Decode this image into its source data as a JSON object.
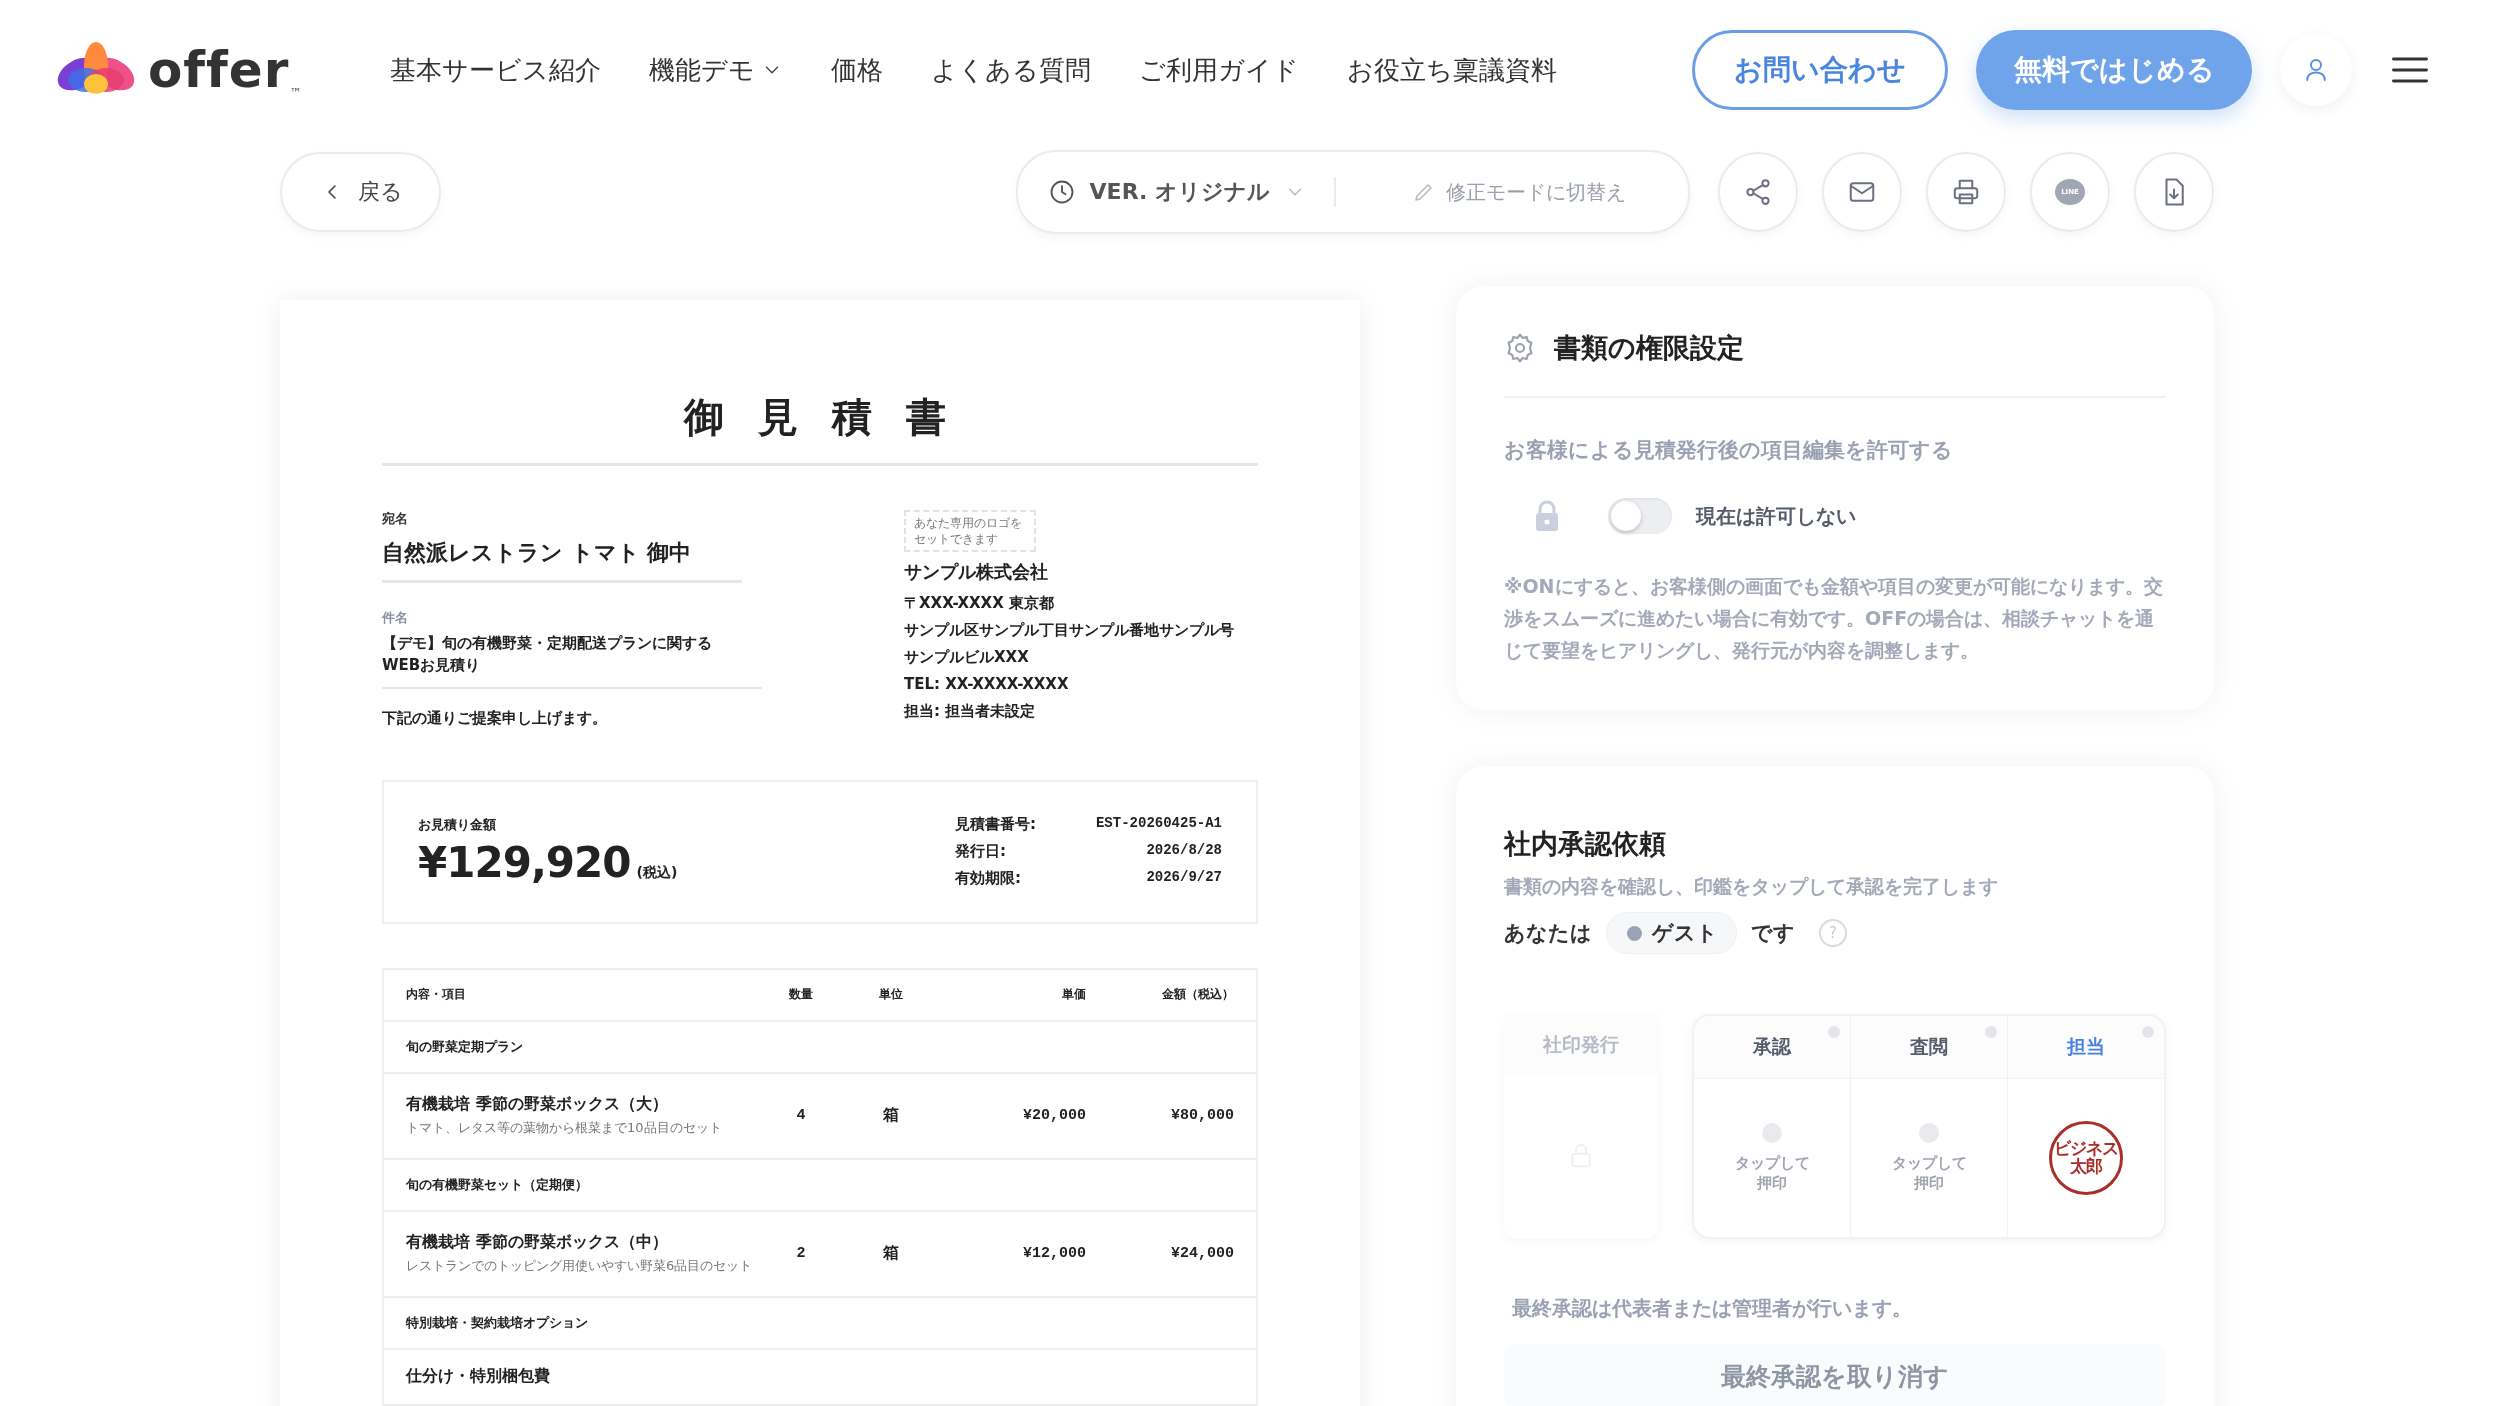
{
  "header": {
    "logo": "offer",
    "logo_mark": "™",
    "nav": [
      {
        "label": "基本サービス紹介",
        "dropdown": false
      },
      {
        "label": "機能デモ",
        "dropdown": true
      },
      {
        "label": "価格",
        "dropdown": false
      },
      {
        "label": "よくある質問",
        "dropdown": false
      },
      {
        "label": "ご利用ガイド",
        "dropdown": false
      },
      {
        "label": "お役立ち稟議資料",
        "dropdown": false
      }
    ],
    "contact_button": "お問い合わせ",
    "start_button": "無料ではじめる"
  },
  "toolbar": {
    "back": "戻る",
    "version": "VER. オリジナル",
    "edit_mode": "修正モードに切替え",
    "actions": [
      {
        "kind": "share"
      },
      {
        "kind": "mail"
      },
      {
        "kind": "print"
      },
      {
        "kind": "line"
      },
      {
        "kind": "download"
      }
    ],
    "line_label": "LINE"
  },
  "document": {
    "title": "御 見 積 書",
    "recipient_label": "宛名",
    "recipient": "自然派レストラン トマト 御中",
    "subject_label": "件名",
    "subject": "【デモ】旬の有機野菜・定期配送プランに関する\nWEBお見積り",
    "intro": "下記の通りご提案申し上げます。",
    "logo_placeholder": "あなた専用のロゴをセットできます",
    "issuer": [
      "サンプル株式会社",
      "〒XXX-XXXX 東京都",
      "サンプル区サンプル丁目サンプル番地サンプル号",
      "サンプルビルXXX",
      "TEL: XX-XXXX-XXXX",
      "担当: 担当者未設定"
    ],
    "total_label": "お見積り金額",
    "total": "¥129,920",
    "total_note": "(税込)",
    "meta": [
      {
        "label": "見積書番号:",
        "value": "EST-20260425-A1"
      },
      {
        "label": "発行日:",
        "value": "2026/8/28"
      },
      {
        "label": "有効期限:",
        "value": "2026/9/27"
      }
    ],
    "table": {
      "columns": [
        "内容・項目",
        "数量",
        "単位",
        "単価",
        "金額（税込）"
      ],
      "rows": [
        {
          "kind": "group",
          "title": "旬の野菜定期プラン"
        },
        {
          "kind": "item",
          "title": "有機栽培 季節の野菜ボックス（大）",
          "note": "トマト、レタス等の葉物から根菜まで10品目のセット",
          "qty": "4",
          "unit": "箱",
          "price": "¥20,000",
          "amount": "¥80,000"
        },
        {
          "kind": "group",
          "title": "旬の有機野菜セット（定期便）"
        },
        {
          "kind": "item",
          "title": "有機栽培 季節の野菜ボックス（中）",
          "note": "レストランでのトッピング用使いやすい野菜6品目のセット",
          "qty": "2",
          "unit": "箱",
          "price": "¥12,000",
          "amount": "¥24,000"
        },
        {
          "kind": "group",
          "title": "特別栽培・契約栽培オプション"
        },
        {
          "kind": "partial",
          "title": "仕分け・特別梱包費"
        }
      ]
    }
  },
  "permissions": {
    "title": "書類の権限設定",
    "label": "お客様による見積発行後の項目編集を許可する",
    "locked": true,
    "toggle_on": false,
    "toggle_label": "現在は許可しない",
    "note": "※ONにすると、お客様側の画面でも金額や項目の変更が可能になります。交渉をスムーズに進めたい場合に有効です。OFFの場合は、相談チャットを通じて要望をヒアリングし、発行元が内容を調整します。"
  },
  "approval": {
    "title": "社内承認依頼",
    "subtitle": "書類の内容を確認し、印鑑をタップして承認を完了します",
    "you_prefix": "あなたは",
    "role": "ゲスト",
    "you_suffix": "です",
    "help": "?",
    "company_seal": {
      "label": "社印発行",
      "locked": true
    },
    "stamps": [
      {
        "label": "承認",
        "kind": "empty",
        "selected": false,
        "hint": "タップして押印"
      },
      {
        "label": "査閲",
        "kind": "empty",
        "selected": false,
        "hint": "タップして押印"
      },
      {
        "label": "担当",
        "kind": "stamped",
        "selected": true,
        "seal": [
          "ビジネス",
          "太郎"
        ]
      }
    ],
    "footnote": "最終承認は代表者または管理者が行います。",
    "cancel_button": "最終承認を取り消す"
  }
}
